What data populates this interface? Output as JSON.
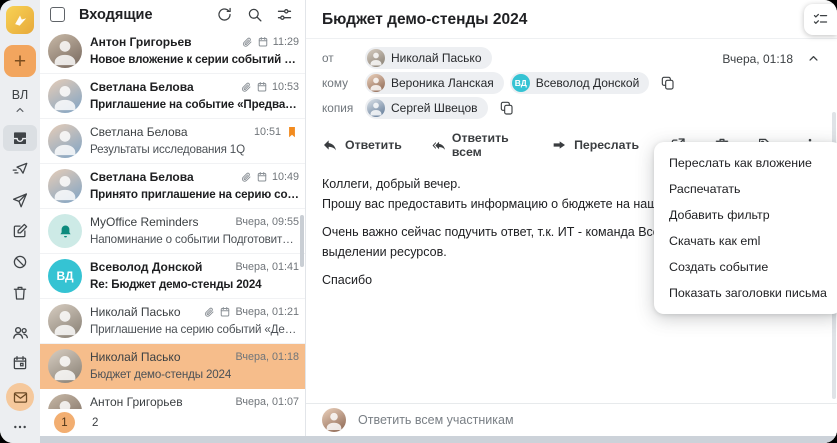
{
  "colors": {
    "accent": "#f2a55e",
    "selection": "#f6bd8b",
    "flag": "#f28b1f",
    "teal_avatar": "#35c3d3"
  },
  "sidebar": {
    "compose_label": "+",
    "profile_initials": "ВЛ",
    "nav_icons": [
      "inbox",
      "outbox",
      "sent",
      "drafts",
      "spam",
      "trash"
    ],
    "app_icons": [
      "contacts",
      "calendar",
      "mail",
      "more"
    ]
  },
  "list": {
    "title": "Входящие",
    "header_icons": [
      "refresh",
      "search",
      "filters"
    ],
    "emails": [
      {
        "sender": "Антон Григорьев",
        "time": "11:29",
        "subject": "Новое вложение к серии событий «Аналити…",
        "unread": true,
        "attachment": true,
        "calendar": true
      },
      {
        "sender": "Светлана Белова",
        "time": "10:53",
        "subject": "Приглашение на событие «Предварительно…",
        "unread": true,
        "attachment": true,
        "calendar": true
      },
      {
        "sender": "Светлана Белова",
        "time": "10:51",
        "subject": "Результаты исследования 1Q",
        "flagged": true
      },
      {
        "sender": "Светлана Белова",
        "time": "10:49",
        "subject": "Принято приглашение на серию событий «…",
        "unread": true,
        "attachment": true,
        "calendar": true
      },
      {
        "sender": "MyOffice Reminders",
        "time": "Вчера, 09:55",
        "subject": "Напоминание о событии Подготовить отчет…",
        "avatar": "bell"
      },
      {
        "sender": "Всеволод Донской",
        "time": "Вчера, 01:41",
        "subject": "Re: Бюджет демо-стенды 2024",
        "unread": true,
        "initials": "ВД"
      },
      {
        "sender": "Николай Пасько",
        "time": "Вчера, 01:21",
        "subject": "Приглашение на серию событий «Демо стен…",
        "attachment": true,
        "calendar": true
      },
      {
        "sender": "Николай Пасько",
        "time": "Вчера, 01:18",
        "subject": "Бюджет демо-стенды 2024",
        "selected": true
      },
      {
        "sender": "Антон Григорьев",
        "time": "Вчера, 01:07",
        "subject": ""
      }
    ],
    "pagination": {
      "current": "1",
      "next": "2"
    }
  },
  "message": {
    "subject": "Бюджет демо-стенды 2024",
    "from_label": "от",
    "from_name": "Николай Пасько",
    "to_label": "кому",
    "to_name_1": "Вероника Ланская",
    "to_name_2": "Всеволод Донской",
    "to_badge_2": "ВД",
    "cc_label": "копия",
    "cc_name": "Сергей Швецов",
    "date": "Вчера, 01:18",
    "actions": {
      "reply": "Ответить",
      "reply_all": "Ответить всем",
      "forward": "Переслать"
    },
    "toolbar_icons": [
      "open-in-new",
      "delete",
      "tag",
      "more"
    ],
    "body": [
      "Коллеги, добрый вечер.",
      "Прошу вас предоставить информацию о бюджете на наши демонстраци",
      "Очень важно сейчас подучить ответ, т.к. ИТ - команда Всеволода, уже",
      "выделении ресурсов.",
      "Спасибо"
    ],
    "reply_placeholder": "Ответить всем участникам"
  },
  "menu": {
    "items": [
      "Переслать как вложение",
      "Распечатать",
      "Добавить фильтр",
      "Скачать как eml",
      "Создать событие",
      "Показать заголовки письма"
    ]
  }
}
